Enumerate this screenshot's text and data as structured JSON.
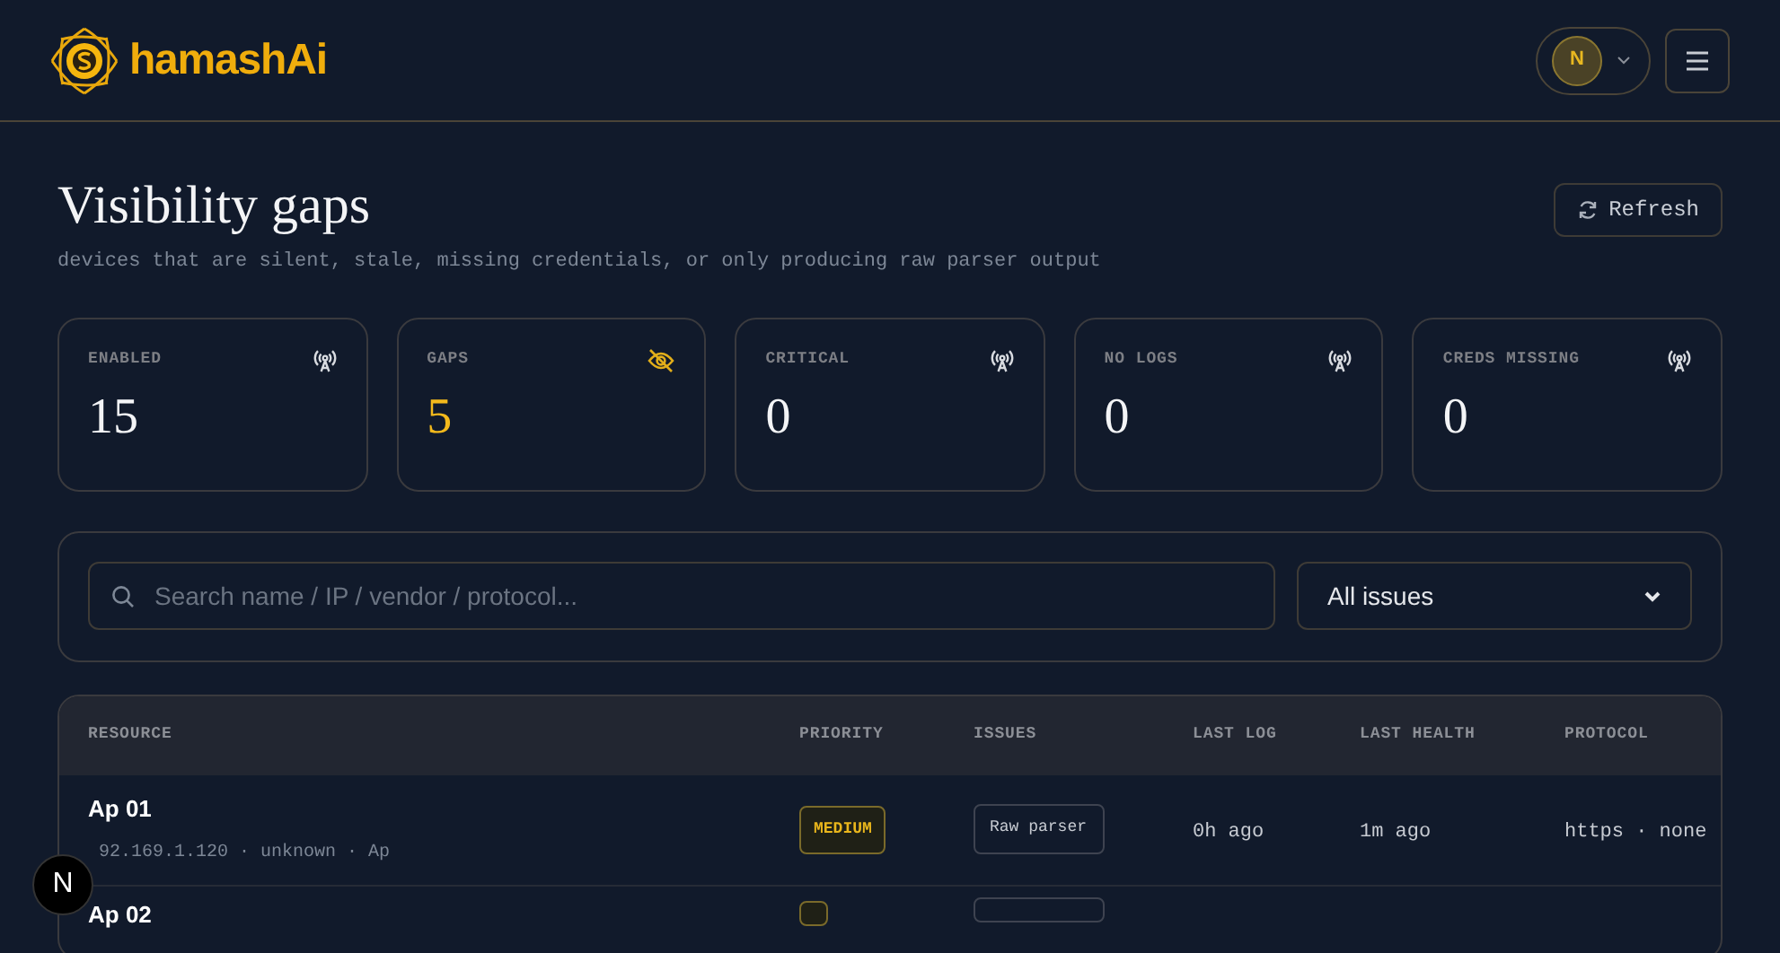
{
  "header": {
    "brand": "hamashAi",
    "avatar_initial": "N"
  },
  "page": {
    "title": "Visibility gaps",
    "subtitle": "devices that are silent, stale, missing credentials, or only producing raw parser output",
    "refresh_button": "Refresh"
  },
  "stats": [
    {
      "label": "ENABLED",
      "value": "15",
      "kind": "tower",
      "highlight": false
    },
    {
      "label": "GAPS",
      "value": "5",
      "kind": "eye-off",
      "highlight": true
    },
    {
      "label": "CRITICAL",
      "value": "0",
      "kind": "tower",
      "highlight": false
    },
    {
      "label": "NO LOGS",
      "value": "0",
      "kind": "tower",
      "highlight": false
    },
    {
      "label": "CREDS MISSING",
      "value": "0",
      "kind": "tower",
      "highlight": false
    }
  ],
  "filters": {
    "search": {
      "placeholder": "Search name / IP / vendor / protocol..."
    },
    "issue_select": "All issues"
  },
  "table": {
    "columns": [
      "RESOURCE",
      "PRIORITY",
      "ISSUES",
      "LAST LOG",
      "LAST HEALTH",
      "PROTOCOL"
    ],
    "rows": [
      {
        "name": "Ap 01",
        "details": "92.169.1.120 · unknown · Ap",
        "priority": "MEDIUM",
        "issues": [
          "Raw parser"
        ],
        "last_log": "0h ago",
        "last_health": "1m ago",
        "protocol": "https · none"
      },
      {
        "name": "Ap 02"
      }
    ]
  },
  "dev_indicator": "N"
}
